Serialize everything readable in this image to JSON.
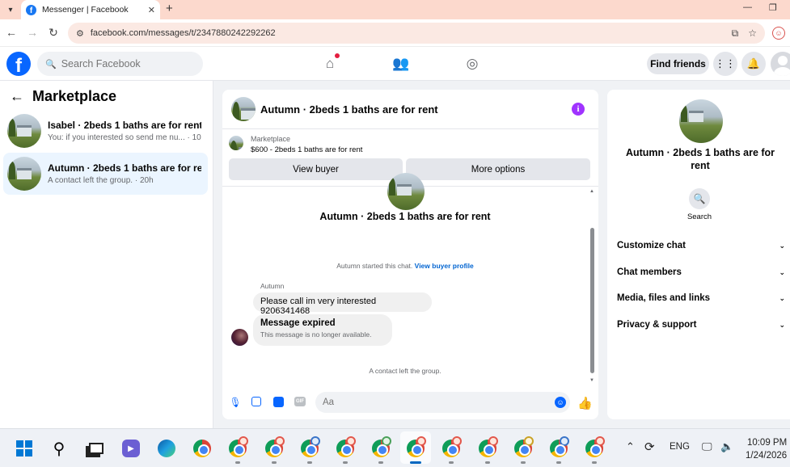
{
  "browser": {
    "tab_title": "Messenger | Facebook",
    "url": "facebook.com/messages/t/2347880242292262",
    "new_tab": "+"
  },
  "fb": {
    "search_placeholder": "Search Facebook",
    "find_friends": "Find friends"
  },
  "sidebar": {
    "title": "Marketplace",
    "conversations": [
      {
        "title": "Isabel · 2beds 1 baths are for rent",
        "preview": "You: if you interested so send me nu... · 10h"
      },
      {
        "title": "Autumn · 2beds 1 baths are for rent",
        "preview": "A contact left the group. · 20h"
      }
    ]
  },
  "chat": {
    "header_name": "Autumn · 2beds 1 baths are for rent",
    "marketplace_label": "Marketplace",
    "listing": "$600 - 2beds 1 baths are for rent",
    "view_buyer": "View buyer",
    "more_options": "More options",
    "conversation_title": "Autumn · 2beds 1 baths are for rent",
    "system_start": "Autumn started this chat.",
    "view_buyer_profile": "View buyer profile",
    "sender_name": "Autumn",
    "message_1": "Please call im very interested 9206341468",
    "expired_title": "Message expired",
    "expired_sub": "This message is no longer available.",
    "system_left": "A contact left the group.",
    "compose_placeholder": "Aa",
    "gif_label": "GIF"
  },
  "right_panel": {
    "title": "Autumn · 2beds 1 baths are for rent",
    "search_label": "Search",
    "rows": [
      "Customize chat",
      "Chat members",
      "Media, files and links",
      "Privacy & support"
    ]
  },
  "taskbar": {
    "language": "ENG",
    "time": "10:09 PM",
    "date": "1/24/2026"
  },
  "colors": {
    "fb_blue": "#0866ff",
    "info_purple": "#a033ff",
    "active_conv": "#ebf5ff",
    "tab_strip": "#fcd9cd"
  }
}
